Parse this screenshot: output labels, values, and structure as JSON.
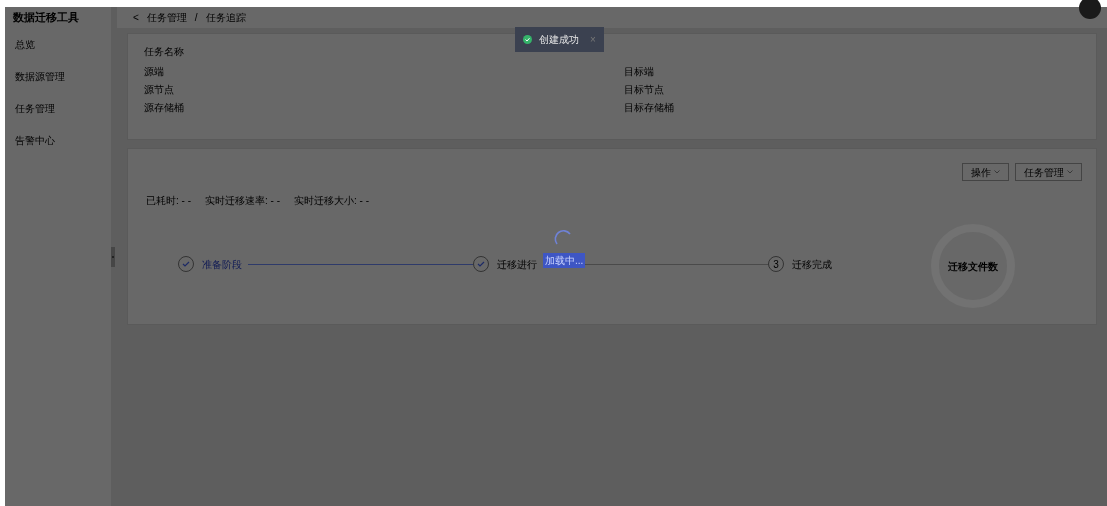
{
  "app_title": "数据迁移工具",
  "sidebar": {
    "items": [
      {
        "label": "总览"
      },
      {
        "label": "数据源管理"
      },
      {
        "label": "任务管理"
      },
      {
        "label": "告警中心"
      }
    ]
  },
  "breadcrumb": {
    "back": "<",
    "items": [
      "任务管理",
      "任务追踪"
    ],
    "separator": "/"
  },
  "toast": {
    "message": "创建成功",
    "close": "×"
  },
  "info_card": {
    "task_name_label": "任务名称",
    "left_fields": [
      "源端",
      "源节点",
      "源存储桶"
    ],
    "right_fields": [
      "目标端",
      "目标节点",
      "目标存储桶"
    ]
  },
  "progress_card": {
    "buttons": [
      {
        "label": "操作"
      },
      {
        "label": "任务管理"
      }
    ],
    "stats": [
      {
        "label": "已耗时:",
        "value": "- -"
      },
      {
        "label": "实时迁移速率:",
        "value": "- -"
      },
      {
        "label": "实时迁移大小:",
        "value": "- -"
      }
    ],
    "steps": [
      {
        "label": "准备阶段",
        "done": true
      },
      {
        "label": "迁移进行",
        "done": true
      },
      {
        "label": "迁移完成",
        "done": false,
        "number": "3"
      }
    ],
    "donut_label": "迁移文件数"
  },
  "loading": {
    "text": "加载中..."
  }
}
